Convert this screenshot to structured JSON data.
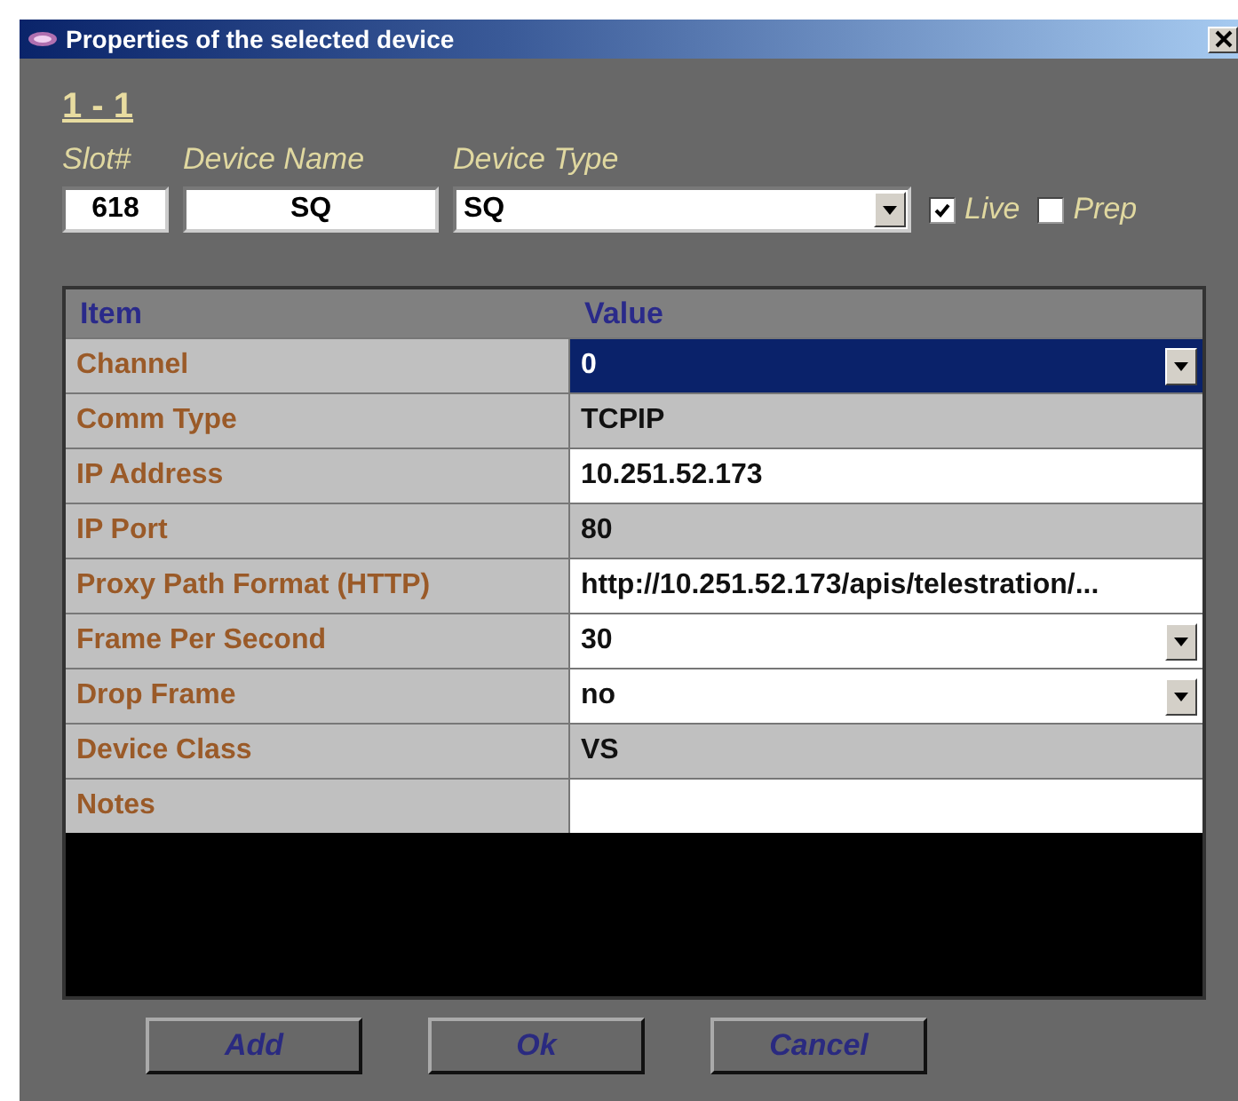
{
  "window": {
    "title": "Properties of the selected device"
  },
  "heading": "1 - 1",
  "fields": [
    {
      "label": "Slot#",
      "value": "618",
      "kind": "text"
    },
    {
      "label": "Device Name",
      "value": "SQ",
      "kind": "text"
    },
    {
      "label": "Device Type",
      "value": "SQ",
      "kind": "dropdown"
    }
  ],
  "checkboxes": [
    {
      "label": "Live",
      "checked": true
    },
    {
      "label": "Prep",
      "checked": false
    }
  ],
  "table": {
    "columns": [
      "Item",
      "Value"
    ],
    "rows": [
      {
        "item": "Channel",
        "value": "0",
        "kind": "dropdown",
        "selected": true
      },
      {
        "item": "Comm Type",
        "value": "TCPIP",
        "kind": "readonly",
        "selected": false
      },
      {
        "item": "IP Address",
        "value": "10.251.52.173",
        "kind": "text",
        "selected": false
      },
      {
        "item": "IP Port",
        "value": "80",
        "kind": "readonly",
        "selected": false
      },
      {
        "item": "Proxy Path Format (HTTP)",
        "value": "http://10.251.52.173/apis/telestration/...",
        "kind": "text",
        "selected": false
      },
      {
        "item": "Frame Per Second",
        "value": "30",
        "kind": "dropdown",
        "selected": false
      },
      {
        "item": "Drop Frame",
        "value": "no",
        "kind": "dropdown",
        "selected": false
      },
      {
        "item": "Device Class",
        "value": "VS",
        "kind": "readonly",
        "selected": false
      },
      {
        "item": "Notes",
        "value": "",
        "kind": "text",
        "selected": false
      }
    ]
  },
  "buttons": [
    "Add",
    "Ok",
    "Cancel"
  ]
}
